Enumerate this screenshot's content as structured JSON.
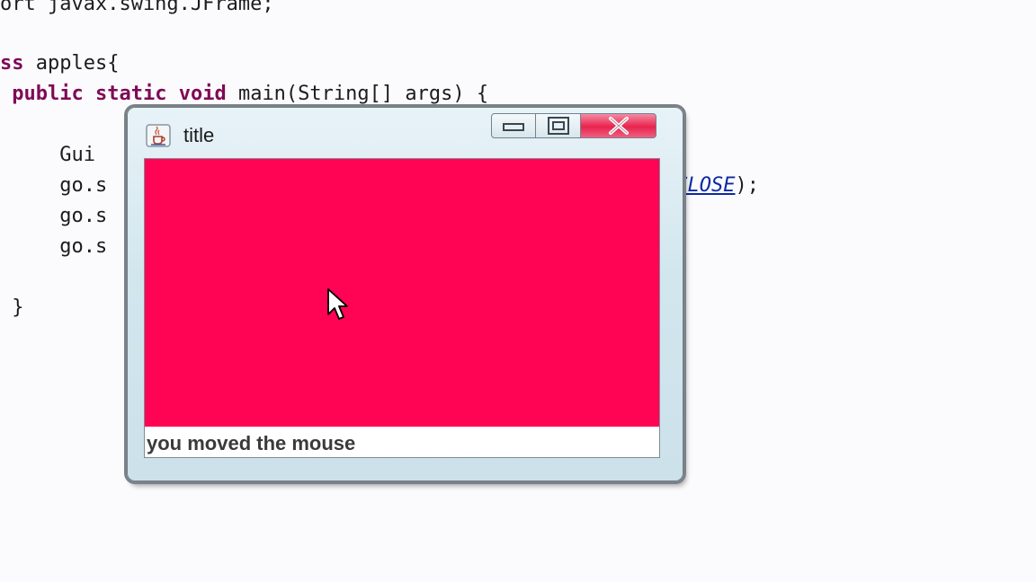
{
  "editor": {
    "lines": [
      {
        "segments": [
          {
            "t": "ort javax.swing.JFrame;",
            "c": ""
          }
        ]
      },
      {
        "segments": [
          {
            "t": "ss",
            "c": "kw"
          },
          {
            "t": " apples{",
            "c": ""
          }
        ]
      },
      {
        "segments": [
          {
            "t": " ",
            "c": ""
          },
          {
            "t": "public",
            "c": "kw"
          },
          {
            "t": " ",
            "c": ""
          },
          {
            "t": "static",
            "c": "kw"
          },
          {
            "t": " ",
            "c": ""
          },
          {
            "t": "void",
            "c": "kw"
          },
          {
            "t": " main(String[] args) {",
            "c": ""
          }
        ]
      },
      {
        "segments": [
          {
            "t": "     Gui ",
            "c": ""
          }
        ]
      },
      {
        "segments": [
          {
            "t": "     go.s",
            "c": ""
          }
        ]
      },
      {
        "segments": [
          {
            "t": "     go.s",
            "c": ""
          }
        ]
      },
      {
        "segments": [
          {
            "t": "     go.s",
            "c": ""
          }
        ]
      },
      {
        "segments": [
          {
            "t": " }",
            "c": ""
          }
        ]
      }
    ],
    "right_fragment": "_CLOSE",
    "right_suffix": ");"
  },
  "window": {
    "title": "title",
    "status_text": "you moved the mouse",
    "panel_color": "#ff0354"
  },
  "icons": {
    "app": "java-cup-icon",
    "minimize": "minimize-icon",
    "maximize": "maximize-icon",
    "close": "close-icon",
    "pointer": "mouse-pointer-icon"
  }
}
